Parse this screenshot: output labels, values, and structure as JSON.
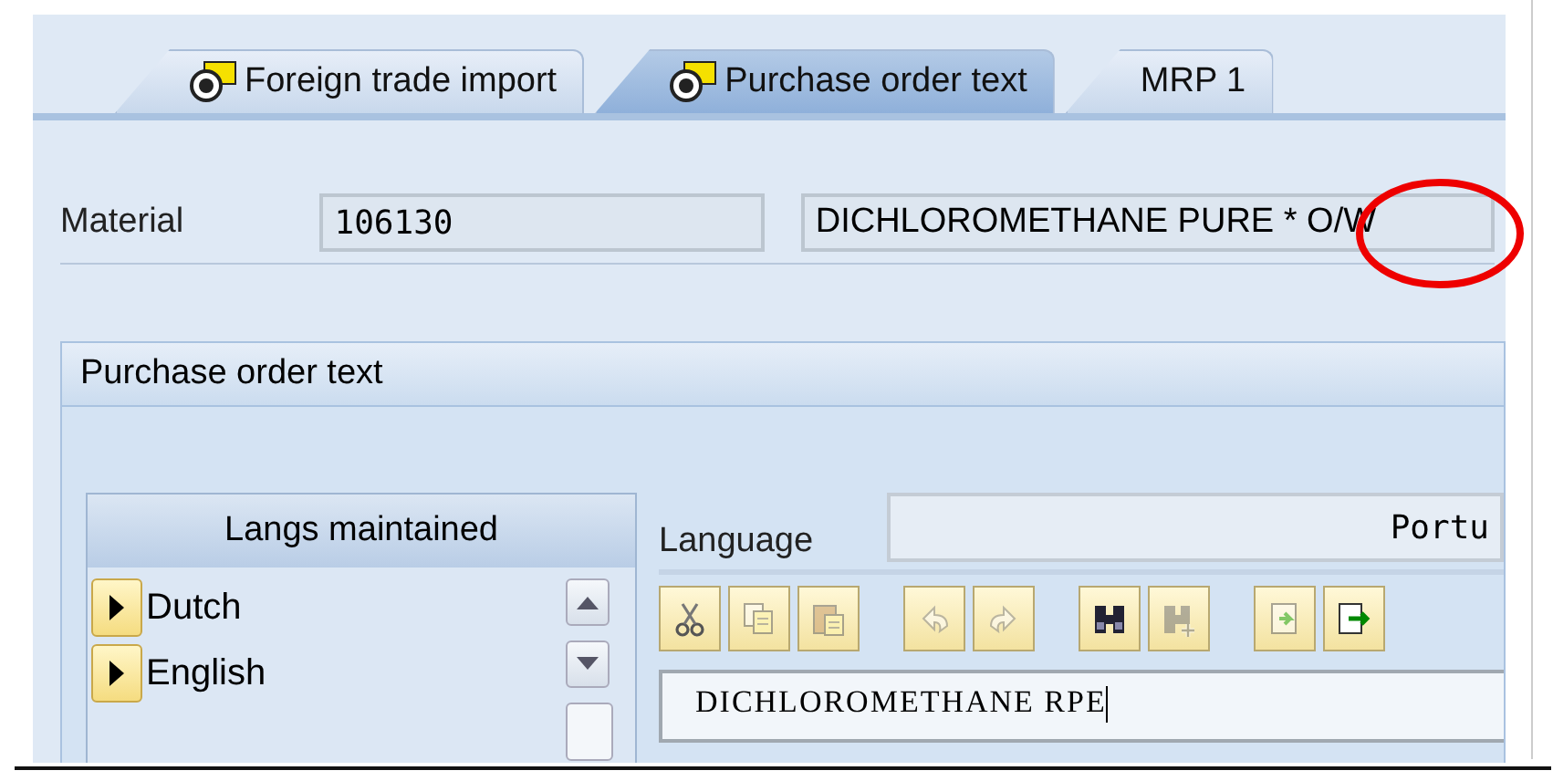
{
  "tabs": [
    {
      "label": "Foreign trade import",
      "selected": false,
      "has_icon": true
    },
    {
      "label": "Purchase order text",
      "selected": true,
      "has_icon": true
    },
    {
      "label": "MRP 1",
      "selected": false,
      "has_icon": false
    }
  ],
  "material": {
    "label": "Material",
    "number": "106130",
    "description": "DICHLOROMETHANE PURE * O/W"
  },
  "group": {
    "title": "Purchase order text",
    "langs_header": "Langs maintained",
    "languages": [
      {
        "name": "Dutch"
      },
      {
        "name": "English"
      }
    ],
    "language_label": "Language",
    "language_value": "Portu",
    "toolbar": [
      {
        "kind": "cut",
        "disabled": false
      },
      {
        "kind": "copy",
        "disabled": true
      },
      {
        "kind": "paste",
        "disabled": true
      },
      {
        "kind": "undo",
        "disabled": true
      },
      {
        "kind": "redo",
        "disabled": true
      },
      {
        "kind": "find",
        "disabled": false
      },
      {
        "kind": "find-next",
        "disabled": true
      },
      {
        "kind": "import",
        "disabled": true
      },
      {
        "kind": "export",
        "disabled": false
      }
    ],
    "text": "DICHLOROMETHANE RPE"
  }
}
